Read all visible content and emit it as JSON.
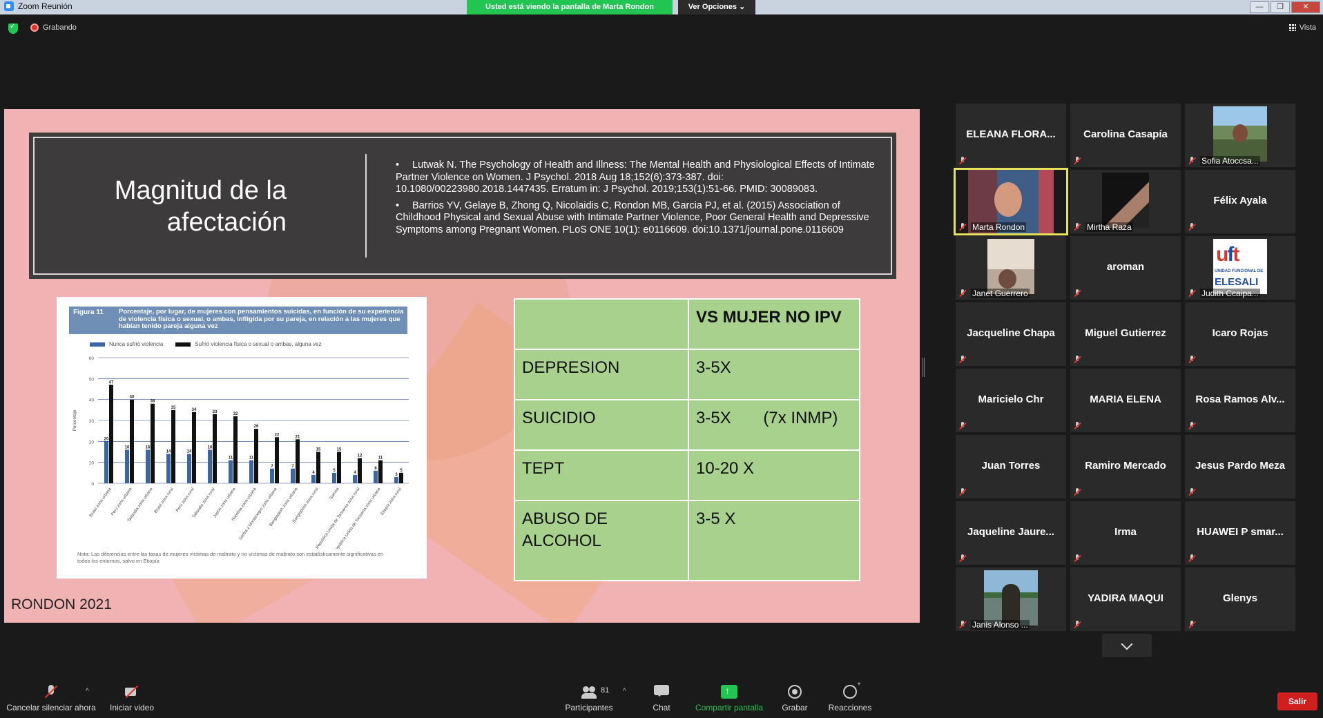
{
  "window": {
    "title": "Zoom Reunión",
    "viewing_banner": "Usted está viendo la pantalla de Marta Rondon",
    "options_label": "Ver Opciones"
  },
  "meeting": {
    "recording_label": "Grabando",
    "view_label": "Vista"
  },
  "slide": {
    "title_line1": "Magnitud de la",
    "title_line2": "afectación",
    "references": [
      "Lutwak N. The Psychology of Health and Illness: The Mental Health and Physiological Effects of Intimate Partner Violence on Women. J Psychol. 2018 Aug 18;152(6):373-387. doi: 10.1080/00223980.2018.1447435. Erratum in: J Psychol. 2019;153(1):51-66. PMID: 30089083.",
      "Barrios YV, Gelaye B, Zhong Q, Nicolaidis C, Rondon MB, Garcia PJ, et al. (2015) Association of Childhood Physical and Sexual Abuse with Intimate Partner Violence, Poor General Health and Depressive Symptoms among Pregnant Women. PLoS ONE 10(1): e0116609. doi:10.1371/journal.pone.0116609"
    ],
    "footer": "RONDON 2021",
    "figure": {
      "tag": "Figura 11",
      "caption": "Porcentaje, por lugar, de mujeres con pensamientos suicidas, en función de su experiencia de violencia física o sexual, o ambas, infligida por su pareja, en relación a las mujeres que habían tenido pareja alguna vez",
      "note": "Nota: Las diferencias entre las tasas de mujeres víctimas de maltrato y no víctimas de maltrato son estadísticamente significativas en todos los entornos, salvo en Etiopía"
    },
    "table": {
      "header": [
        "",
        "VS MUJER NO IPV"
      ],
      "rows": [
        [
          "DEPRESION",
          "3-5X"
        ],
        [
          "SUICIDIO",
          "3-5X       (7x INMP)"
        ],
        [
          "TEPT",
          "10-20 X"
        ],
        [
          "ABUSO DE ALCOHOL",
          "3-5 X"
        ]
      ]
    }
  },
  "chart_data": {
    "type": "bar",
    "ylabel": "Porcentaje",
    "ylim": [
      0,
      60
    ],
    "yticks": [
      0,
      10,
      20,
      30,
      40,
      50,
      60
    ],
    "categories": [
      "Brasil zona urbana",
      "Perú zona urbana",
      "Tailandia zona urbana",
      "Brasil zona rural",
      "Perú zona rural",
      "Tailandia zona rural",
      "Japón zona urbana",
      "Namibia zona urbana",
      "Serbia y Montenegro zona urbana",
      "Bangladesh zona urbana",
      "Bangladesh zona rural",
      "Samoa",
      "República Unida de Tanzanía zona rural",
      "República Unida de Tanzanía zona urbana",
      "Etiopía zona rural"
    ],
    "series": [
      {
        "name": "Nunca sufrió violencia",
        "color": "#3a66a8",
        "values": [
          20,
          16,
          16,
          14,
          14,
          16,
          11,
          11,
          7,
          7,
          4,
          5,
          4,
          6,
          3
        ]
      },
      {
        "name": "Sufrió violencia física o sexual o ambas, alguna vez",
        "color": "#111111",
        "values": [
          47,
          40,
          38,
          35,
          34,
          33,
          32,
          26,
          22,
          21,
          15,
          15,
          12,
          11,
          5
        ]
      }
    ],
    "legend": "top",
    "grid": true
  },
  "gallery": [
    {
      "name": "ELEANA FLORA...",
      "photo": ""
    },
    {
      "name": "Carolina Casapía",
      "photo": ""
    },
    {
      "name": "Sofia Atoccsa...",
      "photo": "sofia"
    },
    {
      "name": "Marta Rondon",
      "photo": "marta",
      "active": true
    },
    {
      "name": "Mirtha Raza",
      "photo": "mirtha"
    },
    {
      "name": "Félix Ayala",
      "photo": ""
    },
    {
      "name": "Janet Guerrero",
      "photo": "janet"
    },
    {
      "name": "aroman",
      "photo": ""
    },
    {
      "name": "Judith Ccaipa...",
      "photo": "judith"
    },
    {
      "name": "Jacqueline Chapa",
      "photo": ""
    },
    {
      "name": "Miguel Gutierrez",
      "photo": ""
    },
    {
      "name": "Icaro Rojas",
      "photo": ""
    },
    {
      "name": "Maricielo Chr",
      "photo": ""
    },
    {
      "name": "MARIA ELENA",
      "photo": ""
    },
    {
      "name": "Rosa Ramos Alv...",
      "photo": ""
    },
    {
      "name": "Juan Torres",
      "photo": ""
    },
    {
      "name": "Ramiro Mercado",
      "photo": ""
    },
    {
      "name": "Jesus Pardo Meza",
      "photo": ""
    },
    {
      "name": "Jaqueline Jaure...",
      "photo": ""
    },
    {
      "name": "Irma",
      "photo": ""
    },
    {
      "name": "HUAWEI P smar...",
      "photo": ""
    },
    {
      "name": "Janis Alonso ...",
      "photo": "janis"
    },
    {
      "name": "YADIRA MAQUI",
      "photo": ""
    },
    {
      "name": "Glenys",
      "photo": ""
    }
  ],
  "judith_logo": {
    "line1": "UNIDAD FUNCIONAL DE",
    "line2": "ELESALI"
  },
  "toolbar": {
    "mute_label": "Cancelar silenciar ahora",
    "video_label": "Iniciar video",
    "participants_label": "Participantes",
    "participants_count": "81",
    "chat_label": "Chat",
    "share_label": "Compartir pantalla",
    "record_label": "Grabar",
    "reactions_label": "Reacciones",
    "exit_label": "Salir"
  }
}
